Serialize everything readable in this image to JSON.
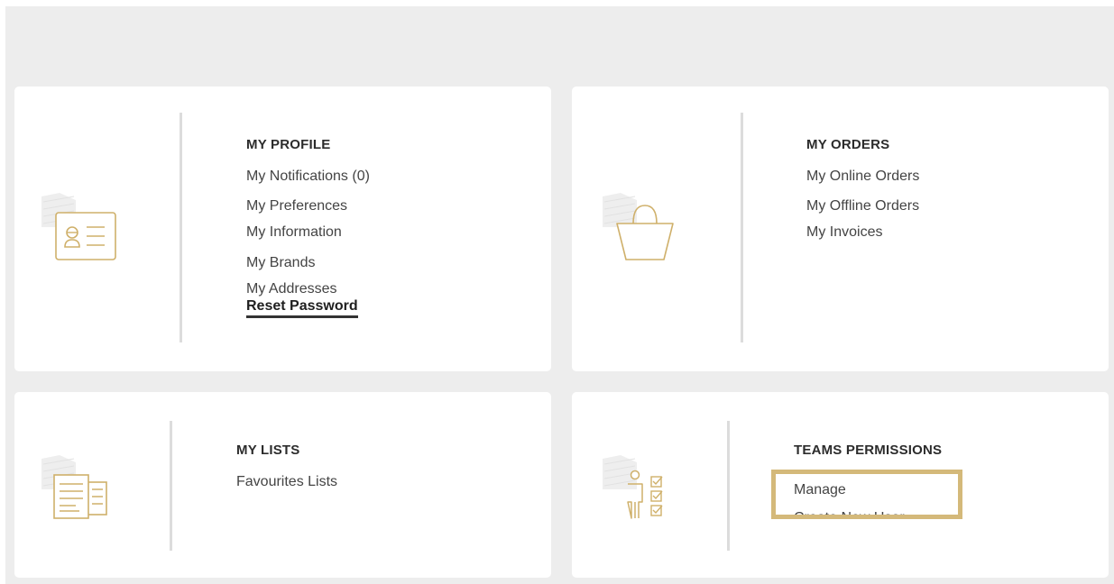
{
  "theme": {
    "accent": "#d4b97a",
    "icon_stroke": "#cfb06a",
    "divider": "#dcdcdc",
    "background": "#ededed"
  },
  "cards": {
    "profile": {
      "icon": "id-card-icon",
      "title": "MY PROFILE",
      "links": [
        "My Notifications (0)",
        "My Preferences",
        "My Information",
        "My Brands",
        "My Addresses",
        "Reset Password"
      ],
      "active_link": "Reset Password"
    },
    "orders": {
      "icon": "shopping-bag-icon",
      "title": "MY ORDERS",
      "links": [
        "My Online Orders",
        "My Offline Orders",
        "My Invoices"
      ]
    },
    "lists": {
      "icon": "documents-icon",
      "title": "MY LISTS",
      "links": [
        "Favourites Lists"
      ]
    },
    "teams": {
      "icon": "user-checklist-icon",
      "title": "TEAMS PERMISSIONS",
      "links": [
        "Manage",
        "Create New User"
      ],
      "highlighted": true
    }
  }
}
